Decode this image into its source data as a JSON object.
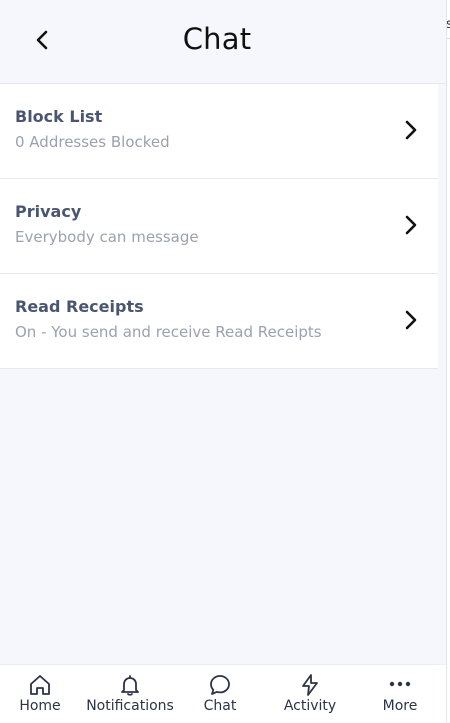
{
  "header": {
    "title": "Chat",
    "back_icon": "chevron-left-icon"
  },
  "settings": [
    {
      "title": "Block List",
      "subtitle": "0 Addresses Blocked",
      "icon": "chevron-right-icon"
    },
    {
      "title": "Privacy",
      "subtitle": "Everybody can message",
      "icon": "chevron-right-icon"
    },
    {
      "title": "Read Receipts",
      "subtitle": "On - You send and receive Read Receipts",
      "icon": "chevron-right-icon"
    }
  ],
  "bottom_nav": [
    {
      "label": "Home",
      "icon": "home-icon"
    },
    {
      "label": "Notifications",
      "icon": "bell-icon"
    },
    {
      "label": "Chat",
      "icon": "chat-bubble-icon"
    },
    {
      "label": "Activity",
      "icon": "lightning-icon"
    },
    {
      "label": "More",
      "icon": "more-dots-icon"
    }
  ],
  "side_panel": {
    "fragment_text": "s"
  },
  "colors": {
    "background": "#f6f7fc",
    "card": "#ffffff",
    "title_text": "#4a5670",
    "subtitle_text": "#9aa1b1",
    "divider": "#e6e8ef"
  }
}
